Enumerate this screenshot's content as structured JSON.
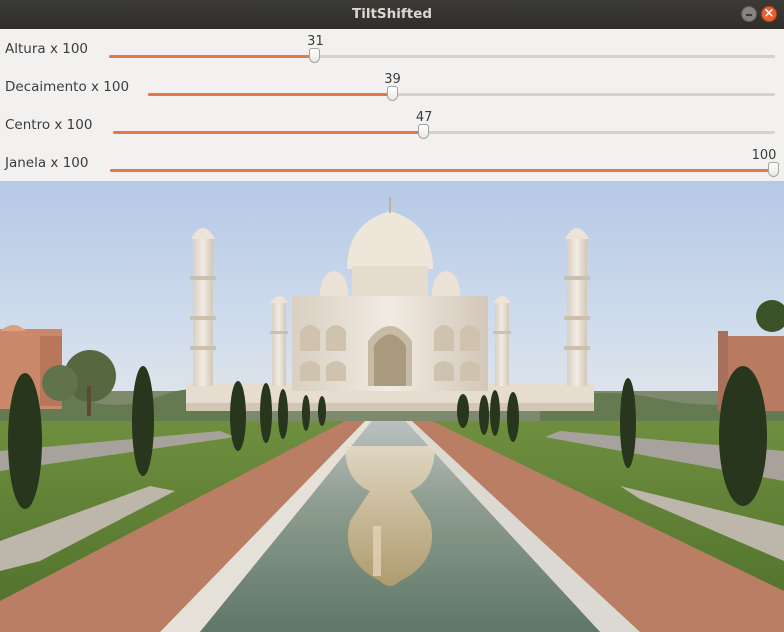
{
  "window": {
    "title": "TiltShifted"
  },
  "sliders": [
    {
      "label": "Altura x 100",
      "value": 31,
      "max": 100
    },
    {
      "label": "Decaimento x 100",
      "value": 39,
      "max": 100
    },
    {
      "label": "Centro x 100",
      "value": 47,
      "max": 100
    },
    {
      "label": "Janela x 100",
      "value": 100,
      "max": 100
    }
  ],
  "colors": {
    "accent": "#e0784a",
    "titlebar": "#33322f",
    "close_button": "#e9602f"
  }
}
